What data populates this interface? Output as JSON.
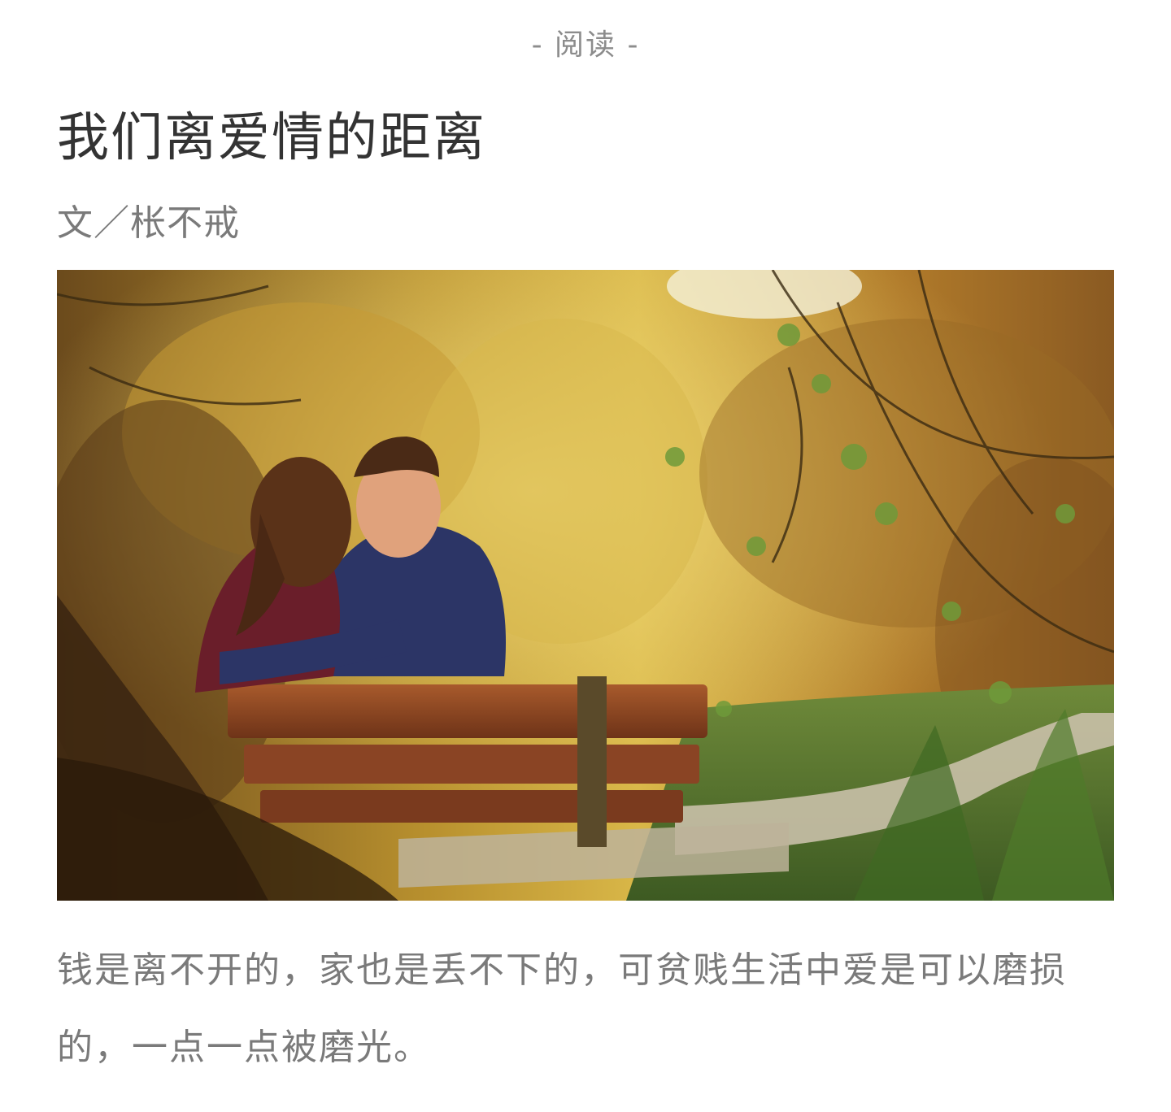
{
  "header": {
    "section_label": "- 阅读 -"
  },
  "article": {
    "title": "我们离爱情的距离",
    "byline": "文／枨不戒",
    "hero_image": {
      "alt": "couple-on-park-bench",
      "icon": "photo-icon"
    },
    "paragraphs": [
      "钱是离不开的，家也是丢不下的，可贫贱生活中爱是可以磨损的，一点一点被磨光。"
    ]
  },
  "colors": {
    "title": "#333333",
    "muted_text": "#7a7a7a",
    "section_label": "#8c8c8c",
    "background": "#ffffff"
  }
}
